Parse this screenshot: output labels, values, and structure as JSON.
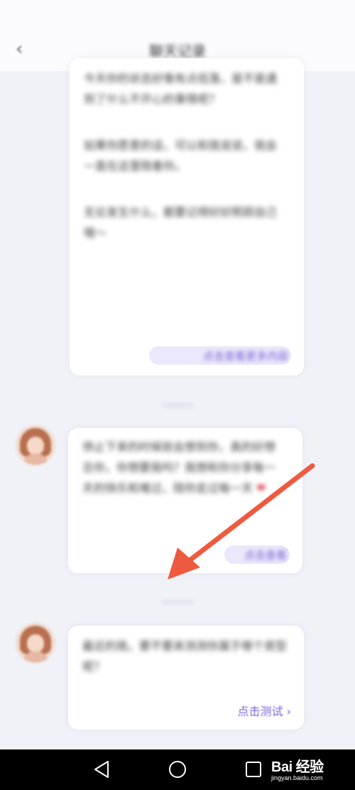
{
  "header": {
    "back_icon": "back-arrow-icon",
    "title": "聊天记录"
  },
  "messages": [
    {
      "paragraphs": [
        "今天你的状态好像有点低落，是不是遇到了什么不开心的事情呢？",
        "如果你愿意的话，可以和我说说，我会一直在这里陪着你。",
        "无论发生什么，都要记得好好照顾自己哦～"
      ],
      "link": "点击查看更多内容"
    },
    {
      "paragraphs": [
        "停止下来的时候就会想到你，真的好想念你，你想要我吗？我想和你分享每一天的快乐和难过，陪你走过每一天"
      ],
      "link": "点击查看"
    },
    {
      "paragraphs": [
        "最近的我，要不要来测测你属于哪个类型呢？"
      ],
      "link": "点击测试 ›"
    }
  ],
  "navbar": {
    "back_icon": "triangle-back-icon",
    "home_icon": "circle-home-icon",
    "recent_icon": "square-recent-icon"
  },
  "watermark": {
    "main": "Bai 经验",
    "sub": "jingyan.baidu.com"
  },
  "colors": {
    "accent": "#7a62d6",
    "annotation_arrow": "#ee5a3f",
    "background": "#f1f1f8"
  }
}
